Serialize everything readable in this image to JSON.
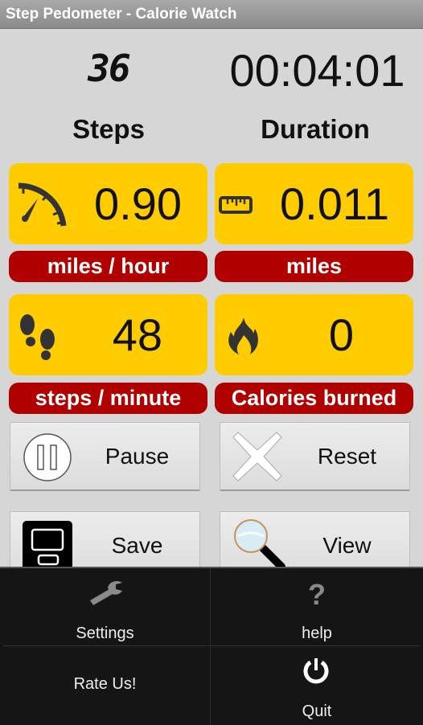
{
  "app": {
    "title": "Step Pedometer - Calorie Watch"
  },
  "counters": {
    "steps_value": "36",
    "steps_label": "Steps",
    "duration_value": "00:04:01",
    "duration_label": "Duration"
  },
  "tiles": [
    {
      "icon": "speedometer-icon",
      "value": "0.90",
      "unit": "miles / hour"
    },
    {
      "icon": "ruler-icon",
      "value": "0.011",
      "unit": "miles"
    },
    {
      "icon": "footprints-icon",
      "value": "48",
      "unit": "steps / minute"
    },
    {
      "icon": "flame-icon",
      "value": "0",
      "unit": "Calories burned"
    }
  ],
  "buttons": {
    "pause": "Pause",
    "reset": "Reset",
    "save": "Save",
    "view": "View"
  },
  "menu": {
    "settings": "Settings",
    "help": "help",
    "rate": "Rate Us!",
    "quit": "Quit"
  },
  "colors": {
    "tile_bg": "#ffcc00",
    "unit_bg": "#b00000",
    "background": "#d6d6d6",
    "menu_bg": "#151515"
  }
}
